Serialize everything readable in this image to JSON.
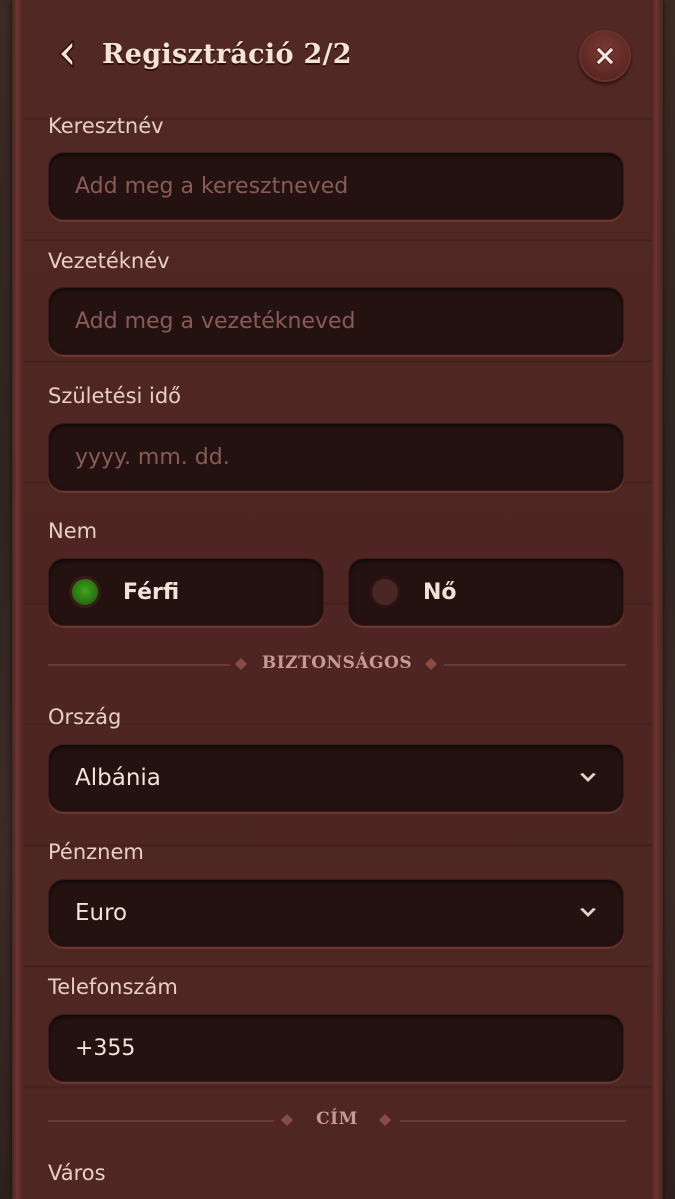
{
  "header": {
    "title": "Regisztráció 2/2"
  },
  "fields": {
    "first_name": {
      "label": "Keresztnév",
      "placeholder": "Add meg a keresztneved"
    },
    "last_name": {
      "label": "Vezetéknév",
      "placeholder": "Add meg a vezetékneved"
    },
    "birth_date": {
      "label": "Születési idő",
      "placeholder": "yyyy. mm. dd."
    },
    "gender": {
      "label": "Nem",
      "options": [
        "Férfi",
        "Nő"
      ],
      "selected": "Férfi"
    },
    "country": {
      "label": "Ország",
      "value": "Albánia"
    },
    "currency": {
      "label": "Pénznem",
      "value": "Euro"
    },
    "phone": {
      "label": "Telefonszám",
      "value": "+355"
    },
    "city": {
      "label": "Város"
    }
  },
  "dividers": {
    "secure": "BIZTONSÁGOS",
    "address": "CÍM"
  },
  "colors": {
    "selected_radio": "#2a7a12",
    "panel": "#4f2623",
    "field": "#231210"
  }
}
